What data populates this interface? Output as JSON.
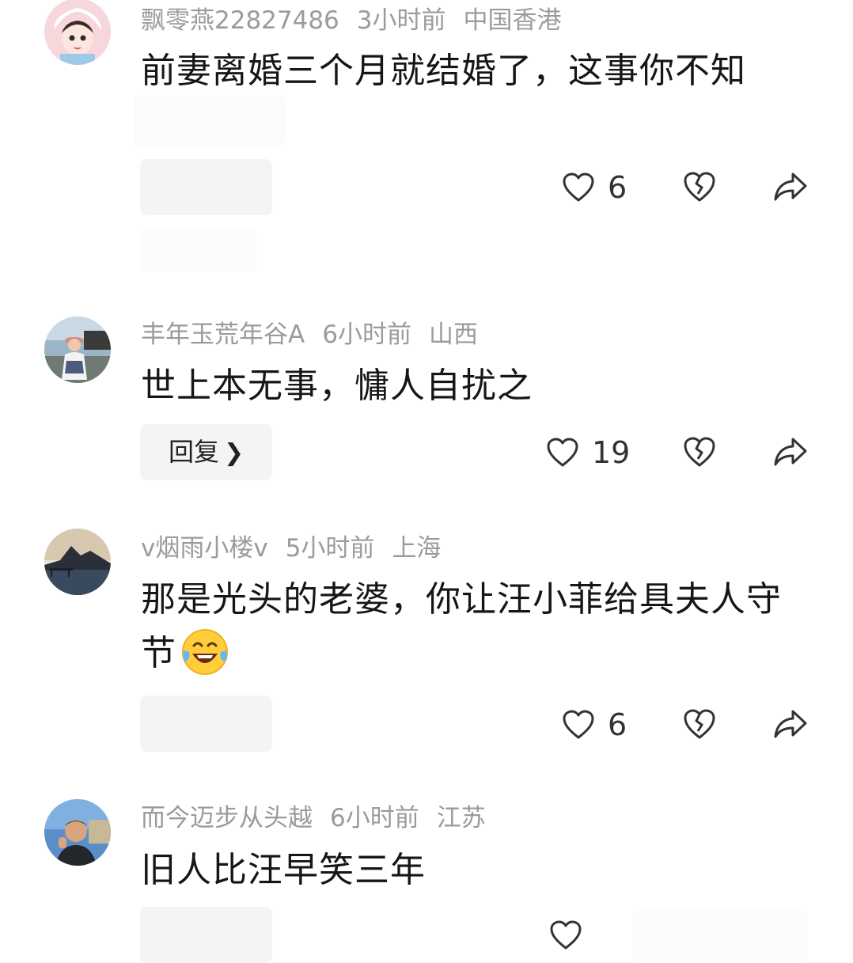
{
  "comments": [
    {
      "username": "飘零燕22827486",
      "time": "3小时前",
      "location": "中国香港",
      "text": "前妻离婚三个月就结婚了，这事你不知",
      "likes": "6",
      "reply_label": ""
    },
    {
      "username": "丰年玉荒年谷A",
      "time": "6小时前",
      "location": "山西",
      "text": "世上本无事，慵人自扰之",
      "likes": "19",
      "reply_label": "回复"
    },
    {
      "username": "v烟雨小楼v",
      "time": "5小时前",
      "location": "上海",
      "text": "那是光头的老婆，你让汪小菲给具夫人守节",
      "likes": "6",
      "reply_label": ""
    },
    {
      "username": "而今迈步从头越",
      "time": "6小时前",
      "location": "江苏",
      "text": "旧人比汪早笑三年",
      "likes": "",
      "reply_label": ""
    }
  ],
  "icons": {
    "like": "heart-outline-icon",
    "dislike": "broken-heart-icon",
    "share": "share-arrow-icon",
    "emoji": "laughing-tears-emoji"
  }
}
